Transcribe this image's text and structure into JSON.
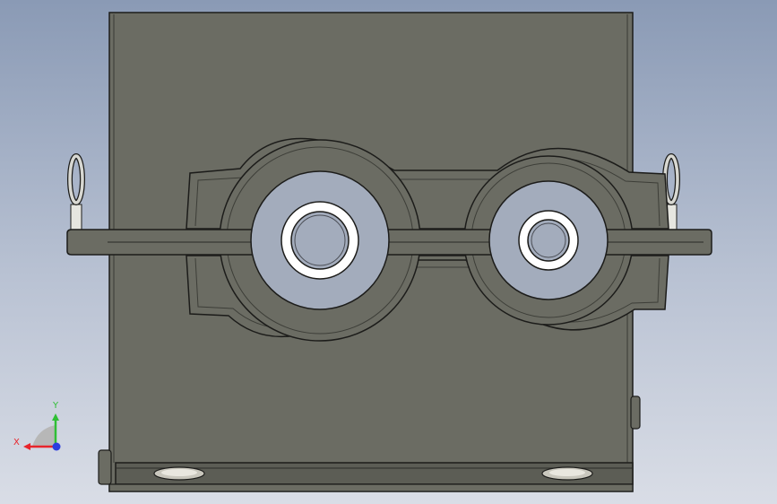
{
  "triad": {
    "x_label": "X",
    "y_label": "Y",
    "x_color": "#e8242b",
    "y_color": "#2fbf35",
    "z_color": "#2b3ce0"
  },
  "colors": {
    "body": "#6b6c63",
    "body_dark": "#55564f",
    "edge": "#1c1c1a",
    "bore_face": "#a3acbc",
    "bushing": "#ffffff",
    "shaft": "#a3acbc"
  }
}
